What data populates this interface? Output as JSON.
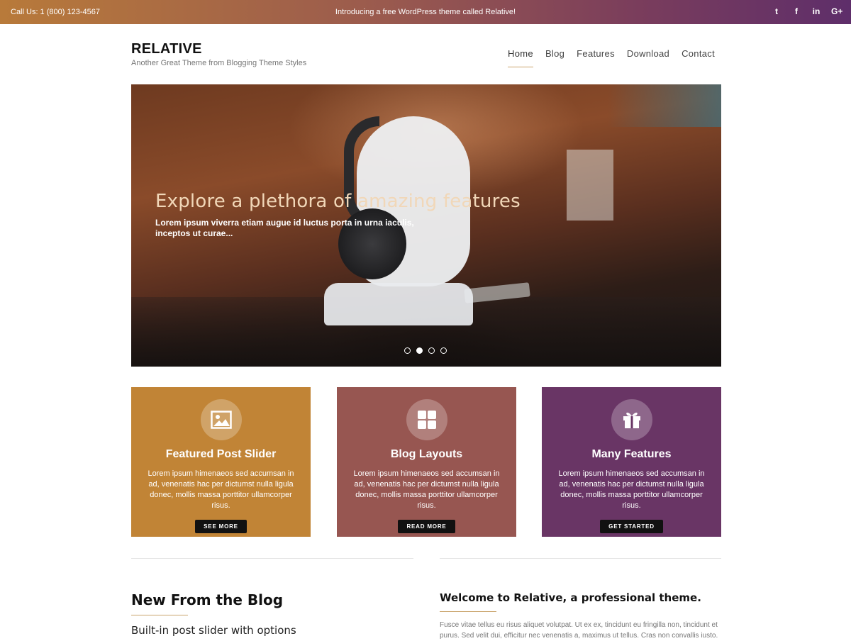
{
  "topbar": {
    "call": "Call Us: 1 (800) 123-4567",
    "announcement": "Introducing a free WordPress theme called Relative!",
    "social": [
      {
        "icon": "twitter-icon",
        "glyph": "t"
      },
      {
        "icon": "facebook-icon",
        "glyph": "f"
      },
      {
        "icon": "linkedin-icon",
        "glyph": "in"
      },
      {
        "icon": "google-plus-icon",
        "glyph": "G+"
      }
    ]
  },
  "header": {
    "site_title": "RELATIVE",
    "tagline": "Another Great Theme from Blogging Theme Styles",
    "nav": [
      "Home",
      "Blog",
      "Features",
      "Download",
      "Contact"
    ],
    "active_nav": "Home"
  },
  "hero": {
    "title": "Explore a plethora of amazing features",
    "text": "Lorem ipsum viverra etiam augue id luctus porta in urna iaculis, inceptos ut curae...",
    "slides": 4,
    "active_slide": 2
  },
  "features": [
    {
      "icon": "image-icon",
      "title": "Featured Post Slider",
      "text": "Lorem ipsum himenaeos sed accumsan in ad, venenatis hac per dictumst nulla ligula donec, mollis massa porttitor ullamcorper risus.",
      "button": "SEE MORE",
      "color": "#c18436"
    },
    {
      "icon": "grid-icon",
      "title": "Blog Layouts",
      "text": "Lorem ipsum himenaeos sed accumsan in ad, venenatis hac per dictumst nulla ligula donec, mollis massa porttitor ullamcorper risus.",
      "button": "READ MORE",
      "color": "#975651"
    },
    {
      "icon": "gift-icon",
      "title": "Many Features",
      "text": "Lorem ipsum himenaeos sed accumsan in ad, venenatis hac per dictumst nulla ligula donec, mollis massa porttitor ullamcorper risus.",
      "button": "GET STARTED",
      "color": "#693565"
    }
  ],
  "blog": {
    "heading": "New From the Blog",
    "subheading": "Built-in post slider with options"
  },
  "welcome": {
    "heading": "Welcome to Relative, a professional theme.",
    "text": "Fusce vitae tellus eu risus aliquet volutpat. Ut ex ex, tincidunt eu fringilla non, tincidunt et purus. Sed velit dui, efficitur nec venenatis a, maximus ut tellus. Cras non convallis iusto."
  },
  "colors": {
    "accent_gold": "#c9a46b",
    "topbar_start": "#b87a3a",
    "topbar_end": "#5e2e6a"
  }
}
